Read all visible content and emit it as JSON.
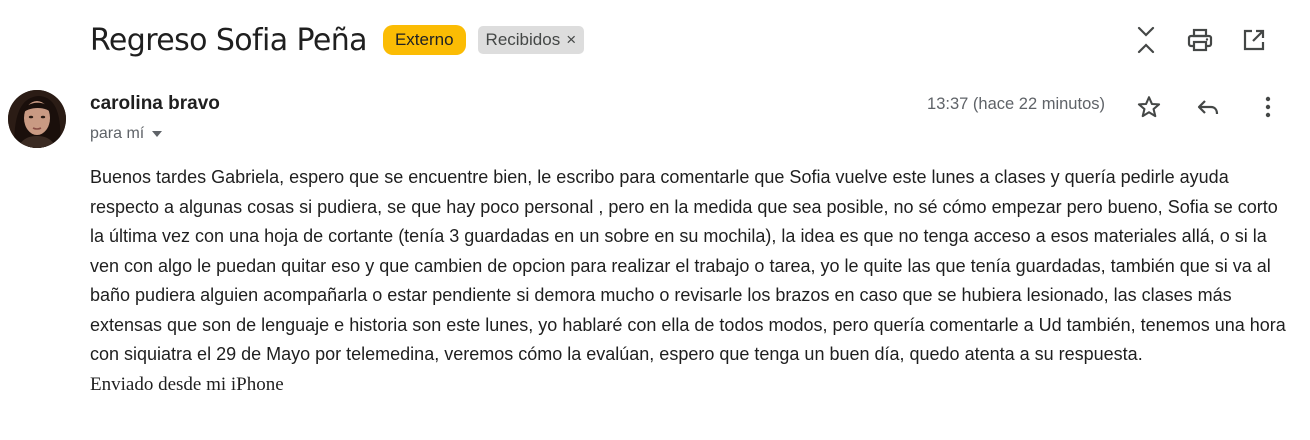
{
  "thread": {
    "subject": "Regreso Sofia Peña",
    "labels": [
      {
        "name": "Externo",
        "color": "#fbbc04"
      },
      {
        "name": "Recibidos",
        "removable": true,
        "remove_glyph": "×"
      }
    ],
    "toolbar_icons": [
      "collapse-all-icon",
      "print-icon",
      "open-in-new-window-icon"
    ]
  },
  "message": {
    "sender_name": "carolina bravo",
    "recipient_text": "para mí",
    "time": "13:37 (hace 22 minutos)",
    "action_icons": [
      "star-icon",
      "reply-icon",
      "more-vert-icon"
    ],
    "body": "Buenos tardes Gabriela, espero que se encuentre bien, le escribo para  comentarle que Sofia vuelve este lunes a clases y quería pedirle ayuda respecto a algunas cosas si pudiera, se que hay poco personal , pero en la medida que sea posible, no sé cómo empezar pero bueno, Sofia se corto la última vez con una hoja de cortante (tenía 3 guardadas en un sobre en su mochila), la idea es que no tenga acceso a esos materiales allá, o si la ven con algo le puedan quitar eso y que cambien de opcion para realizar el trabajo o tarea,  yo le quite las que tenía guardadas, también que si va al baño pudiera alguien acompañarla o estar pendiente si demora mucho o revisarle los brazos en caso que se hubiera lesionado, las clases más extensas que son de lenguaje e historia son este lunes, yo hablaré con ella de todos modos, pero quería comentarle a Ud también, tenemos una hora con siquiatra el 29 de Mayo por telemedina, veremos cómo la evalúan, espero que tenga un buen día, quedo atenta  a su respuesta.",
    "signature": "Enviado desde mi iPhone"
  }
}
